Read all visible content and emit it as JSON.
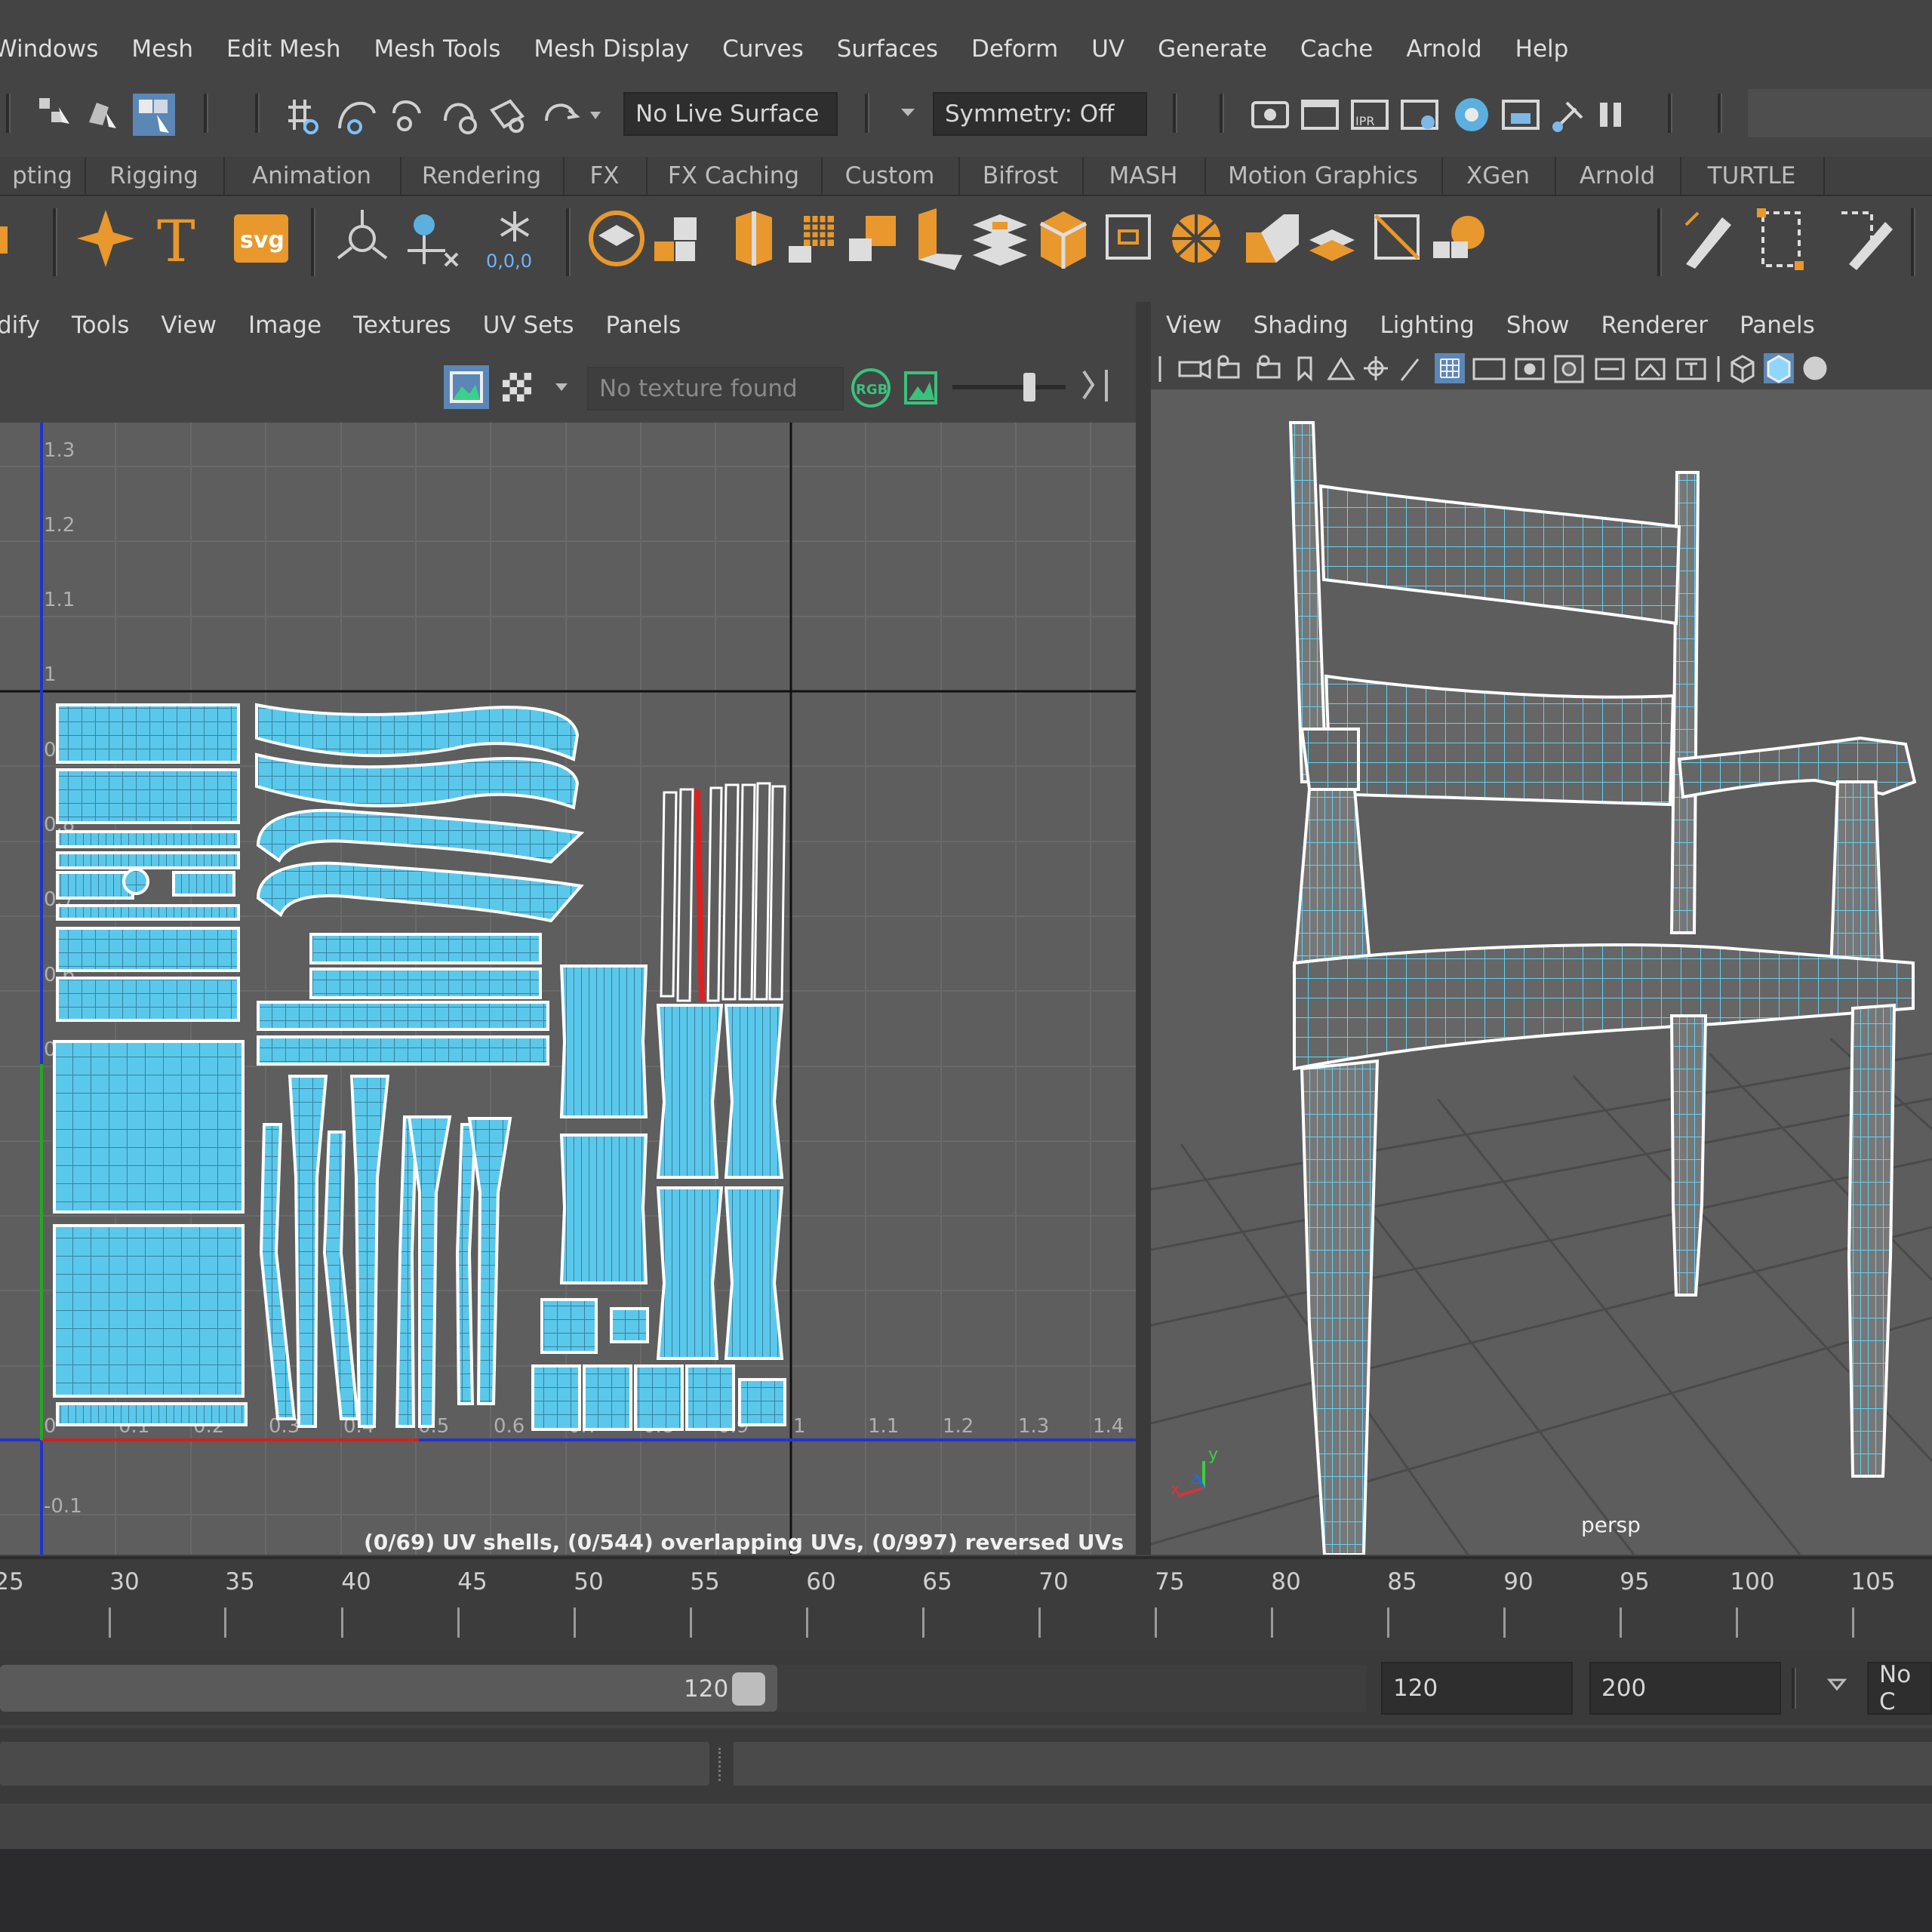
{
  "menubar": {
    "items": [
      "Windows",
      "Mesh",
      "Edit Mesh",
      "Mesh Tools",
      "Mesh Display",
      "Curves",
      "Surfaces",
      "Deform",
      "UV",
      "Generate",
      "Cache",
      "Arnold",
      "Help"
    ]
  },
  "statusline": {
    "live_surface": "No Live Surface",
    "symmetry": "Symmetry: Off"
  },
  "shelf_tabs": [
    "pting",
    "Rigging",
    "Animation",
    "Rendering",
    "FX",
    "FX Caching",
    "Custom",
    "Bifrost",
    "MASH",
    "Motion Graphics",
    "XGen",
    "Arnold",
    "TURTLE"
  ],
  "shelf": {
    "text_icon": "T",
    "svg_icon": "svg",
    "snow_label": "0,0,0"
  },
  "uv_editor": {
    "menu": [
      "dify",
      "Tools",
      "View",
      "Image",
      "Textures",
      "UV Sets",
      "Panels"
    ],
    "texture_field": "No texture found",
    "rgb_label": "RGB",
    "v_ticks": [
      "1.3",
      "1.2",
      "1.1",
      "1",
      "0.9",
      "0.8",
      "0.7",
      "0.6",
      "0.5",
      "-0.1"
    ],
    "u_ticks": [
      "0",
      "0.1",
      "0.2",
      "0.3",
      "0.4",
      "0.5",
      "0.6",
      "0.7",
      "0.8",
      "0.9",
      "1",
      "1.1",
      "1.2",
      "1.3",
      "1.4"
    ],
    "status": "(0/69) UV shells, (0/544) overlapping UVs, (0/997) reversed UVs"
  },
  "viewport": {
    "menu": [
      "View",
      "Shading",
      "Lighting",
      "Show",
      "Renderer",
      "Panels"
    ],
    "camera_label": "persp",
    "axis_y": "y",
    "axis_z": "z",
    "axis_x": "x"
  },
  "timeline": {
    "ticks": [
      "25",
      "30",
      "35",
      "40",
      "45",
      "50",
      "55",
      "60",
      "65",
      "70",
      "75",
      "80",
      "85",
      "90",
      "95",
      "100",
      "105"
    ]
  },
  "range": {
    "slider_value": "120",
    "end_time": "120",
    "anim_end": "200",
    "char_set": "No C"
  },
  "colors": {
    "uv_shell_fill": "#5ac8ea",
    "uv_border": "#ffffff",
    "u_axis": "#cc2222",
    "v_axis": "#2233cc",
    "accent_orange": "#e8982c",
    "wire_cyan": "#5fd3f5"
  }
}
